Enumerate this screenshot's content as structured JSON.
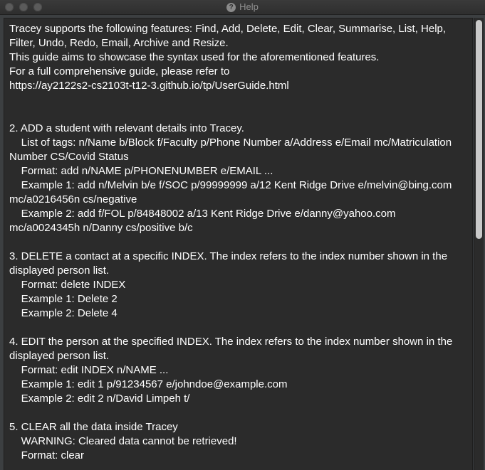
{
  "window": {
    "title": "Help"
  },
  "help": {
    "text": "Tracey supports the following features: Find, Add, Delete, Edit, Clear, Summarise, List, Help,\nFilter, Undo, Redo, Email, Archive and Resize.\nThis guide aims to showcase the syntax used for the aforementioned features.\nFor a full comprehensive guide, please refer to\nhttps://ay2122s2-cs2103t-t12-3.github.io/tp/UserGuide.html\n\n\n2. ADD a student with relevant details into Tracey.\n    List of tags: n/Name b/Block f/Faculty p/Phone Number a/Address e/Email mc/Matriculation\nNumber CS/Covid Status\n    Format: add n/NAME p/PHONENUMBER e/EMAIL ...\n    Example 1: add n/Melvin b/e f/SOC p/99999999 a/12 Kent Ridge Drive e/melvin@bing.com\nmc/a0216456n cs/negative\n    Example 2: add f/FOL p/84848002 a/13 Kent Ridge Drive e/danny@yahoo.com\nmc/a0024345h n/Danny cs/positive b/c\n\n3. DELETE a contact at a specific INDEX. The index refers to the index number shown in the\ndisplayed person list.\n    Format: delete INDEX\n    Example 1: Delete 2\n    Example 2: Delete 4\n\n4. EDIT the person at the specified INDEX. The index refers to the index number shown in the\ndisplayed person list.\n    Format: edit INDEX n/NAME ...\n    Example 1: edit 1 p/91234567 e/johndoe@example.com\n    Example 2: edit 2 n/David Limpeh t/\n\n5. CLEAR all the data inside Tracey\n    WARNING: Cleared data cannot be retrieved!\n    Format: clear"
  },
  "colors": {
    "background": "#3c3f41",
    "text_area": "#2b2b2b",
    "text": "#ffffff",
    "scroll_thumb": "#c9c9c9"
  },
  "icons": {
    "title": "help-icon"
  }
}
